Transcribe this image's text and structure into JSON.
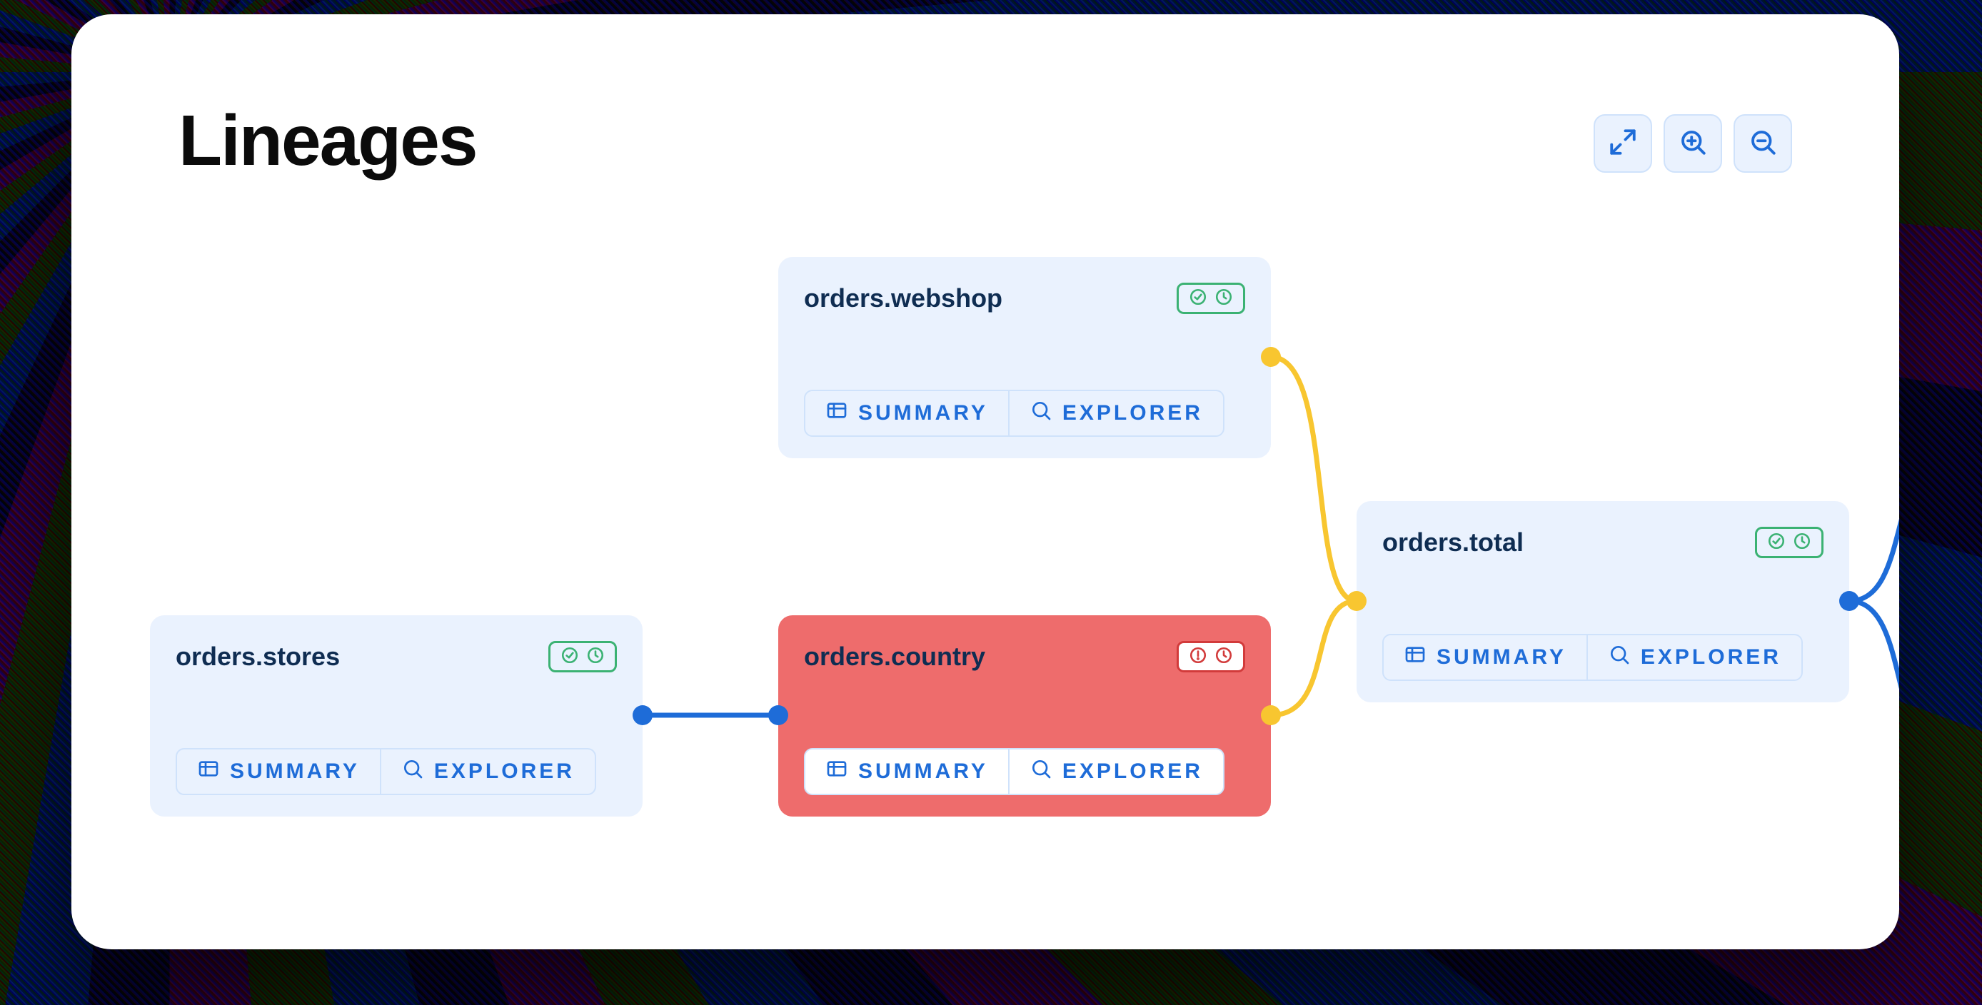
{
  "title": "Lineages",
  "controls": {
    "expand": "expand",
    "zoom_in": "zoom-in",
    "zoom_out": "zoom-out"
  },
  "actions": {
    "summary": "SUMMARY",
    "explorer": "EXPLORER"
  },
  "nodes": {
    "webshop": {
      "label": "orders.webshop",
      "status": "ok"
    },
    "country": {
      "label": "orders.country",
      "status": "error"
    },
    "stores": {
      "label": "orders.stores",
      "status": "ok"
    },
    "total": {
      "label": "orders.total",
      "status": "ok"
    }
  },
  "edges": [
    {
      "from": "stores",
      "to": "country",
      "color": "blue"
    },
    {
      "from": "webshop",
      "to": "total",
      "color": "yellow"
    },
    {
      "from": "country",
      "to": "total",
      "color": "yellow"
    },
    {
      "from": "total",
      "to": "offscreen-top",
      "color": "blue"
    },
    {
      "from": "total",
      "to": "offscreen-bottom",
      "color": "blue"
    }
  ],
  "colors": {
    "node_blue": "#eaf2fe",
    "node_red": "#EE6C6C",
    "accent_blue": "#1E6CD8",
    "accent_yellow": "#F8C630",
    "status_ok": "#3BB273",
    "status_err": "#D23B3B"
  }
}
